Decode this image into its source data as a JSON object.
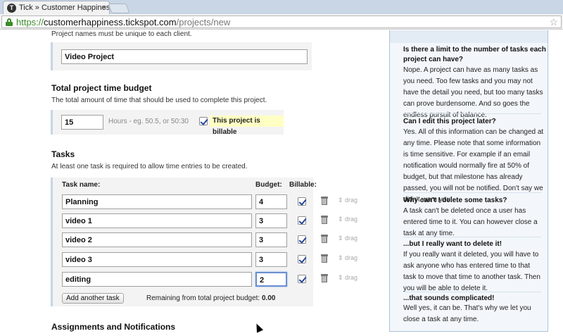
{
  "browser": {
    "tab_title": "Tick » Customer Happiness",
    "tab_close": "×",
    "favicon_letter": "T",
    "url_scheme": "https://",
    "url_host": "customerhappiness.tickspot.com",
    "url_path": "/projects/new",
    "star_glyph": "☆"
  },
  "form": {
    "project_name_hint": "Project names must be unique to each client.",
    "project_name_value": "Video Project",
    "budget_heading": "Total project time budget",
    "budget_hint": "The total amount of time that should be used to complete this project.",
    "budget_value": "15",
    "budget_format_hint": "Hours - eg. 50.5, or 50:30",
    "billable_label": "This project is billable",
    "tasks_heading": "Tasks",
    "tasks_hint": "At least one task is required to allow time entries to be created.",
    "col_task_name": "Task name:",
    "col_budget": "Budget:",
    "col_billable": "Billable:",
    "drag_label": "⇕ drag",
    "tasks": [
      {
        "name": "Planning",
        "budget": "4"
      },
      {
        "name": "video 1",
        "budget": "3"
      },
      {
        "name": "video 2",
        "budget": "3"
      },
      {
        "name": "video 3",
        "budget": "3"
      },
      {
        "name": "editing",
        "budget": "2"
      }
    ],
    "add_task_button": "Add another task",
    "remaining_label": "Remaining from total project budget:",
    "remaining_value": "0.00",
    "assignments_heading": "Assignments and Notifications"
  },
  "sidebar": {
    "faq": [
      {
        "q": "Is there a limit to the number of tasks each",
        "q2": "project can have?",
        "a": "Nope. A project can have as many tasks as you need. Too few tasks and you may not have the detail you need, but too many tasks can prove burdensome. And so goes the endless pursuit of balance."
      },
      {
        "q": "Can I edit this project later?",
        "a": "Yes. All of this information can be changed at any time. Please note that some information is time sensitive. For example if an email notification would normally fire at 50% of budget, but that milestone has already passed, you will not be notified. Don't say we didn't warn you!"
      },
      {
        "q": "Why can't I delete some tasks?",
        "a": "A task can't be deleted once a user has entered time to it. You can however close a task at any time."
      },
      {
        "q": "...but I really want to delete it!",
        "a": "If you really want it deleted, you will have to ask anyone who has entered time to that task to move that time to another task. Then you will be able to delete it."
      },
      {
        "q": "...that sounds complicated!",
        "a": "Well yes, it can be. That's why we let you close a task at any time."
      }
    ]
  }
}
